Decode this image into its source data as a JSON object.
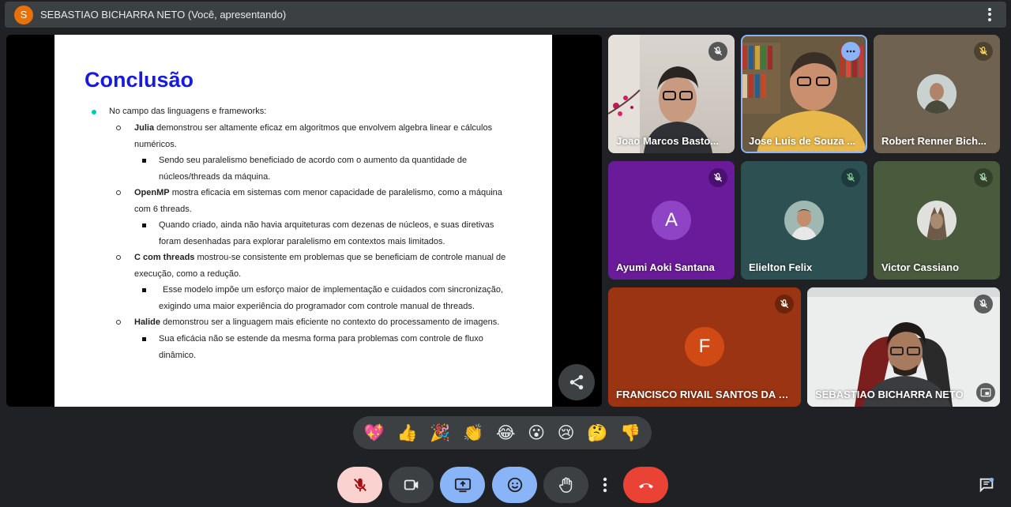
{
  "presenter_bar": {
    "avatar_letter": "S",
    "title": "SEBASTIAO BICHARRA NETO (Você, apresentando)"
  },
  "slide": {
    "title": "Conclusão",
    "intro": "No campo das linguagens e frameworks:",
    "julia_bold": "Julia",
    "julia_text_1": "demonstrou ser altamente eficaz em algoritmos que envolvem algebra linear e cálculos",
    "julia_text_2": "numéricos.",
    "julia_sub_1": "Sendo seu paralelismo beneficiado de acordo com o aumento da quantidade de",
    "julia_sub_2": "núcleos/threads da máquina.",
    "openmp_bold": "OpenMP",
    "openmp_text_1": "mostra eficacia em sistemas com menor capacidade de paralelismo, como a máquina",
    "openmp_text_2": "com 6 threads.",
    "openmp_sub_1": "Quando criado, ainda não havia arquiteturas com dezenas de núcleos, e suas diretivas",
    "openmp_sub_2": "foram desenhadas para explorar paralelismo em contextos mais limitados.",
    "c_bold": "C com threads",
    "c_text_1": "mostrou-se consistente em problemas que se beneficiam de controle manual de",
    "c_text_2": "execução, como a redução.",
    "c_sub_1": "Esse modelo impõe um esforço maior de implementação e cuidados com sincronização,",
    "c_sub_2": "exigindo uma maior experiência do programador com controle manual de threads.",
    "halide_bold": "Halide",
    "halide_text_1": "demonstrou ser a linguagem mais eficiente no contexto do processamento de imagens.",
    "halide_sub_1": "Sua eficácia não se estende da mesma forma para problemas com controle de fluxo",
    "halide_sub_2": "dinâmico."
  },
  "participants": [
    {
      "name": "Joao Marcos Basto..."
    },
    {
      "name": "Jose Luis de Souza ..."
    },
    {
      "name": "Robert Renner Bich..."
    },
    {
      "name": "Ayumi Aoki Santana",
      "letter": "A",
      "color": "#6a1b9a"
    },
    {
      "name": "Elielton Felix"
    },
    {
      "name": "Victor Cassiano"
    },
    {
      "name": "FRANCISCO RIVAIL SANTOS DA L...",
      "letter": "F",
      "color": "#b23a12"
    },
    {
      "name": "SEBASTIAO BICHARRA NETO"
    }
  ],
  "reactions": [
    "💖",
    "👍",
    "🎉",
    "👏",
    "😂",
    "😮",
    "😢",
    "🤔",
    "👎"
  ],
  "colors": {
    "mic_off_bg": "#fad2cf",
    "active_blue": "#8ab4f8",
    "hangup_red": "#ea4335",
    "control_gray": "#3c4043"
  }
}
